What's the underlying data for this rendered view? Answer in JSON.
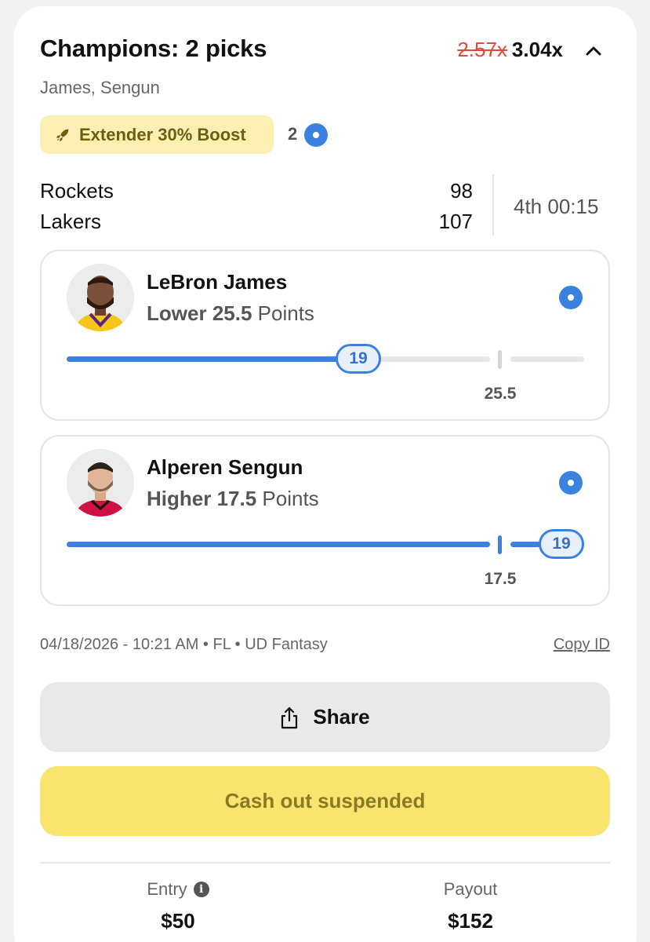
{
  "header": {
    "title": "Champions: 2 picks",
    "old_multiplier": "2.57x",
    "new_multiplier": "3.04x",
    "subtitle": "James, Sengun"
  },
  "boost": {
    "label": "Extender 30% Boost",
    "count": "2",
    "icon": "rocket-icon"
  },
  "game": {
    "teams": [
      {
        "name": "Rockets",
        "score": "98"
      },
      {
        "name": "Lakers",
        "score": "107"
      }
    ],
    "clock": "4th 00:15"
  },
  "picks": [
    {
      "player": "LeBron James",
      "direction": "Lower",
      "line": "25.5",
      "stat": "Points",
      "current": "19",
      "current_value": 19,
      "tick_label": "25.5",
      "jersey_color": "#f5c518"
    },
    {
      "player": "Alperen Sengun",
      "direction": "Higher",
      "line": "17.5",
      "stat": "Points",
      "current": "19",
      "current_value": 19,
      "tick_label": "17.5",
      "jersey_color": "#ce1141"
    }
  ],
  "meta": {
    "info": "04/18/2026 - 10:21 AM • FL • UD Fantasy",
    "copy_id": "Copy ID"
  },
  "buttons": {
    "share": "Share",
    "cash_out": "Cash out suspended"
  },
  "footer": {
    "entry_label": "Entry",
    "entry_value": "$50",
    "payout_label": "Payout",
    "payout_value": "$152"
  },
  "colors": {
    "accent_blue": "#3b82e0",
    "boost_bg": "#fbefb4",
    "cash_out_bg": "#f9e46e",
    "strike_red": "#e04a3a"
  }
}
